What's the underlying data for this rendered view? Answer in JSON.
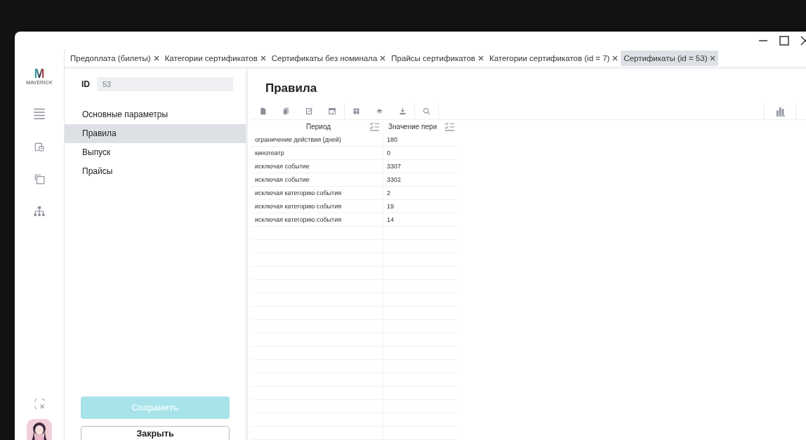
{
  "tabs": [
    {
      "label": "Предоплата (билеты)",
      "selected": false
    },
    {
      "label": "Категории сертификатов",
      "selected": false
    },
    {
      "label": "Сертификаты без номинала",
      "selected": false
    },
    {
      "label": "Прайсы сертификатов",
      "selected": false
    },
    {
      "label": "Категории сертификатов (id = 7)",
      "selected": false
    },
    {
      "label": "Сертификаты (id = 53)",
      "selected": true
    }
  ],
  "logo": {
    "mark": "M",
    "name": "MAVERICK"
  },
  "id_field": {
    "label": "ID",
    "value": "53"
  },
  "nav": [
    {
      "label": "Основные параметры",
      "selected": false
    },
    {
      "label": "Правила",
      "selected": true
    },
    {
      "label": "Выпуск",
      "selected": false
    },
    {
      "label": "Прайсы",
      "selected": false
    }
  ],
  "buttons": {
    "save": {
      "label": "Сохранить",
      "disabled": true
    },
    "close": {
      "label": "Закрыть",
      "disabled": false
    }
  },
  "panel": {
    "title": "Правила"
  },
  "table": {
    "columns": [
      "Период",
      "Значение пери"
    ],
    "rows": [
      [
        "ограничение действия (дней)",
        "180"
      ],
      [
        "кинотеатр",
        "0"
      ],
      [
        "исключая событие",
        "3307"
      ],
      [
        "исключая событие",
        "3302"
      ],
      [
        "исключая категорию события",
        "2"
      ],
      [
        "исключая категорию события",
        "19"
      ],
      [
        "исключая категорию события",
        "14"
      ]
    ]
  }
}
